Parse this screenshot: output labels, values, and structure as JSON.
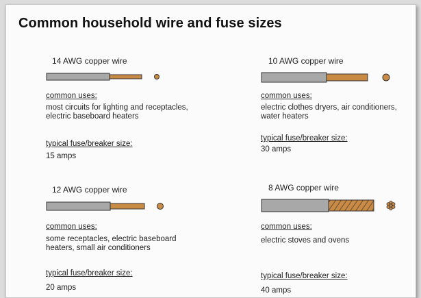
{
  "title": "Common household wire and fuse sizes",
  "colors": {
    "insulation": "#a8a8a8",
    "copper": "#c98a44",
    "outline": "#333333"
  },
  "wires": [
    {
      "name": "14 AWG copper wire",
      "uses_label": "common uses:",
      "uses": "most circuits for lighting and receptacles, electric baseboard heaters",
      "fuse_label": "typical fuse/breaker size:",
      "fuse": "15 amps",
      "conductor": "solid"
    },
    {
      "name": "10 AWG copper wire",
      "uses_label": "common uses:",
      "uses": "electric clothes dryers, air conditioners, water heaters",
      "fuse_label": "typical fuse/breaker size:",
      "fuse": "30 amps",
      "conductor": "solid"
    },
    {
      "name": "12 AWG copper wire",
      "uses_label": "common uses:",
      "uses": "some receptacles, electric baseboard heaters, small air conditioners",
      "fuse_label": "typical fuse/breaker size:",
      "fuse": "20 amps",
      "conductor": "solid"
    },
    {
      "name": "8 AWG copper wire",
      "uses_label": "common uses:",
      "uses": "electric stoves and ovens",
      "fuse_label": "typical fuse/breaker size:",
      "fuse": "40 amps",
      "conductor": "stranded"
    }
  ]
}
